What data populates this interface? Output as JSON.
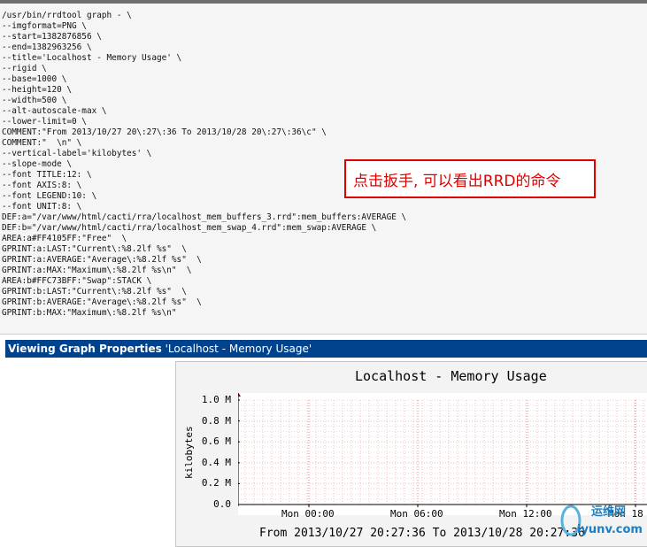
{
  "command": {
    "lines": [
      "/usr/bin/rrdtool graph - \\",
      "--imgformat=PNG \\",
      "--start=1382876856 \\",
      "--end=1382963256 \\",
      "--title='Localhost - Memory Usage' \\",
      "--rigid \\",
      "--base=1000 \\",
      "--height=120 \\",
      "--width=500 \\",
      "--alt-autoscale-max \\",
      "--lower-limit=0 \\",
      "COMMENT:\"From 2013/10/27 20\\:27\\:36 To 2013/10/28 20\\:27\\:36\\c\" \\",
      "COMMENT:\"  \\n\" \\",
      "--vertical-label='kilobytes' \\",
      "--slope-mode \\",
      "--font TITLE:12: \\",
      "--font AXIS:8: \\",
      "--font LEGEND:10: \\",
      "--font UNIT:8: \\",
      "DEF:a=\"/var/www/html/cacti/rra/localhost_mem_buffers_3.rrd\":mem_buffers:AVERAGE \\",
      "DEF:b=\"/var/www/html/cacti/rra/localhost_mem_swap_4.rrd\":mem_swap:AVERAGE \\",
      "AREA:a#FF4105FF:\"Free\"  \\",
      "GPRINT:a:LAST:\"Current\\:%8.2lf %s\"  \\",
      "GPRINT:a:AVERAGE:\"Average\\:%8.2lf %s\"  \\",
      "GPRINT:a:MAX:\"Maximum\\:%8.2lf %s\\n\"  \\",
      "AREA:b#FFC73BFF:\"Swap\":STACK \\",
      "GPRINT:b:LAST:\"Current\\:%8.2lf %s\"  \\",
      "GPRINT:b:AVERAGE:\"Average\\:%8.2lf %s\"  \\",
      "GPRINT:b:MAX:\"Maximum\\:%8.2lf %s\\n\""
    ]
  },
  "annotation": {
    "text": "点击扳手, 可以看出RRD的命令",
    "color": "#e00000"
  },
  "section_header": {
    "label": "Viewing Graph Properties",
    "graph_name": "'Localhost - Memory Usage'",
    "background": "#00438c"
  },
  "graph": {
    "title": "Localhost - Memory Usage",
    "vertical_label": "kilobytes",
    "range_text": "From 2013/10/27 20:27:36 To 2013/10/28 20:27:36",
    "y_ticks": [
      "1.0 M",
      "0.8 M",
      "0.6 M",
      "0.4 M",
      "0.2 M",
      "0.0"
    ],
    "x_ticks": [
      "Mon 00:00",
      "Mon 06:00",
      "Mon 12:00",
      "Mon 18"
    ]
  },
  "chart_data": {
    "type": "area",
    "title": "Localhost - Memory Usage",
    "ylabel": "kilobytes",
    "ylim": [
      0,
      1000000
    ],
    "yticks": [
      0,
      200000,
      400000,
      600000,
      800000,
      1000000
    ],
    "ytick_labels": [
      "0.0",
      "0.2 M",
      "0.4 M",
      "0.6 M",
      "0.8 M",
      "1.0 M"
    ],
    "xtick_labels": [
      "Mon 00:00",
      "Mon 06:00",
      "Mon 12:00",
      "Mon 18"
    ],
    "grid": true,
    "series": []
  },
  "watermark": {
    "top": "运维网",
    "bottom": "iyunv.com"
  }
}
